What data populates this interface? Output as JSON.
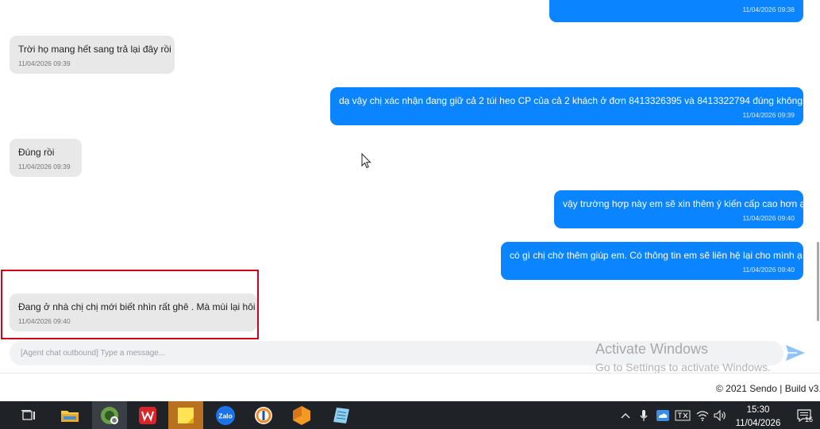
{
  "messages": [
    {
      "dir": "out",
      "text": "",
      "time": "11/04/2026 09:38"
    },
    {
      "dir": "in",
      "text": "Trời họ mang hết sang trả lại đây rồi",
      "time": "11/04/2026 09:39"
    },
    {
      "dir": "out",
      "text": "dạ vậy chị xác nhận đang giữ cả 2 túi heo CP của cả 2 khách ở đơn  8413326395 và 8413322794 đúng không ạ?",
      "time": "11/04/2026 09:39"
    },
    {
      "dir": "in",
      "text": "Đúng rồi",
      "time": "11/04/2026 09:39"
    },
    {
      "dir": "out",
      "text": "vậy trường hợp này em sẽ xin thêm ý kiến cấp cao hơn ạ",
      "time": "11/04/2026 09:40"
    },
    {
      "dir": "out",
      "text": "có gì chị chờ thêm giúp em. Có thông tin em sẽ liên hệ lại cho mình ạ",
      "time": "11/04/2026 09:40"
    },
    {
      "dir": "in",
      "text": "Đang ở nhà chị chị mới biết nhìn rất ghê . Mà mùi lại hôi",
      "time": "11/04/2026 09:40"
    }
  ],
  "composer": {
    "placeholder": "[Agent chat outbound] Type a message..."
  },
  "watermark": {
    "line1": "Activate Windows",
    "line2": "Go to Settings to activate Windows."
  },
  "footer": {
    "text": "© 2021 Sendo | Build v3.0"
  },
  "taskbar": {
    "apps": [
      "task-view-icon",
      "file-explorer-icon",
      "coccoc-browser-icon",
      "wps-office-icon",
      "sticky-notes-icon",
      "zalo-icon",
      "ultraviewer-icon",
      "sublime-icon",
      "notepad-icon"
    ],
    "zalo_label": "Zalo",
    "clock_time": "15:30",
    "clock_date": "11/04/2026",
    "notification_count": "16"
  },
  "colors": {
    "outgoing": "#0a84ff",
    "incoming": "#e8e8e8",
    "highlight": "#d0021b",
    "taskbar": "#1f2328"
  }
}
